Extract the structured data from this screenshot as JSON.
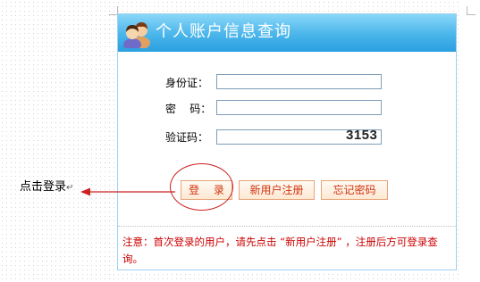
{
  "panel": {
    "title": "个人账户信息查询",
    "icon": "users-icon"
  },
  "form": {
    "id_label": "身份证：",
    "id_value": "",
    "password_label": "密    码：",
    "password_value": "",
    "captcha_label": "验证码：",
    "captcha_value": "",
    "captcha_code": "3153"
  },
  "buttons": {
    "login": "登 录",
    "register": "新用户注册",
    "forgot": "忘记密码"
  },
  "notice": "注意：首次登录的用户，请先点击 “新用户注册” ，注册后方可登录查询。",
  "annotation": {
    "text": "点击登录",
    "paragraph_mark": "↵"
  },
  "colors": {
    "header_gradient_top": "#8ad7f8",
    "header_gradient_bottom": "#2b9fe0",
    "button_text": "#d0330e",
    "button_border": "#e8a57a",
    "notice_text": "#cc0000",
    "callout": "#cc2222"
  }
}
